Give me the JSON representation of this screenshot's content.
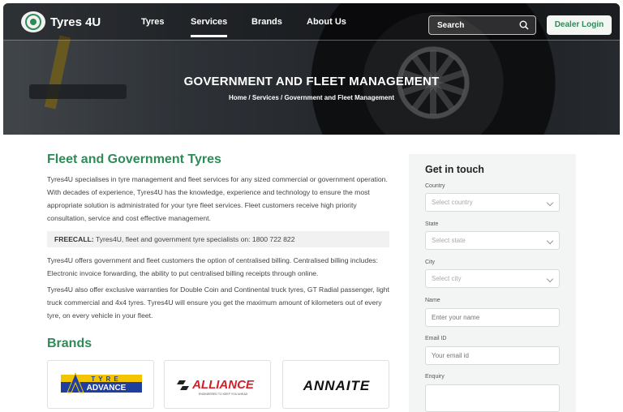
{
  "header": {
    "logo_text": "Tyres 4U",
    "nav": [
      "Tyres",
      "Services",
      "Brands",
      "About Us"
    ],
    "active_nav": "Services",
    "search_placeholder": "Search",
    "dealer_login": "Dealer Login"
  },
  "hero": {
    "title": "GOVERNMENT AND FLEET MANAGEMENT",
    "breadcrumb": "Home / Services / Government and Fleet Management"
  },
  "main": {
    "heading": "Fleet and Government Tyres",
    "para1": "Tyres4U specialises in tyre management and fleet services for any sized commercial or government operation. With decades of experience, Tyres4U has the knowledge, experience and technology to ensure the most appropriate solution is administrated for your tyre fleet services. Fleet customers receive high priority consultation, service and cost effective management.",
    "freecall_label": "FREECALL:",
    "freecall_text": "Tyres4U, fleet and government tyre specialists on: 1800 722 822",
    "para2": "Tyres4U offers government and fleet customers the option of centralised billing. Centralised billing includes: Electronic invoice forwarding, the ability to put centralised billing receipts through online.",
    "para3": "Tyres4U also offer exclusive warranties for Double Coin and Continental truck tyres, GT Radial passenger, light truck commercial and 4x4 tyres. Tyres4U will ensure you get the maximum amount of kilometers out of every tyre, on every vehicle in your fleet.",
    "brands_heading": "Brands",
    "brands": [
      {
        "tyre_word": "TYRE",
        "name": "ADVANCE"
      },
      {
        "name": "ALLIANCE",
        "tagline": "ENGINEERED TO KEEP YOU AHEAD"
      },
      {
        "name": "ANNAITE"
      }
    ]
  },
  "contact": {
    "title": "Get in touch",
    "fields": [
      {
        "label": "Country",
        "placeholder": "Select country"
      },
      {
        "label": "State",
        "placeholder": "Select state"
      },
      {
        "label": "City",
        "placeholder": "Select city"
      },
      {
        "label": "Name",
        "placeholder": "Enter your name"
      },
      {
        "label": "Email ID",
        "placeholder": "Your email id"
      },
      {
        "label": "Enquiry",
        "placeholder": ""
      }
    ]
  },
  "colors": {
    "accent": "#2e8b57",
    "advance_blue": "#1f3f9f",
    "advance_yellow": "#f2c500",
    "alliance_red": "#d21f2a"
  }
}
